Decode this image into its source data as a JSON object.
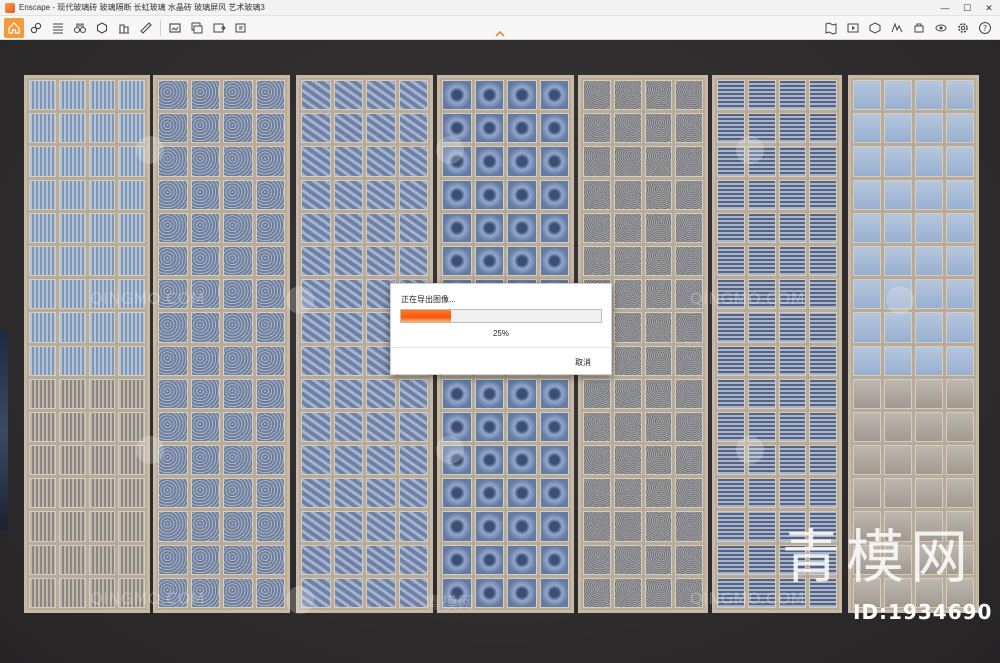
{
  "window": {
    "title": "Enscape - 现代玻璃砖 玻璃隔断 长虹玻璃 水晶砖 玻璃屏风 艺术玻璃3",
    "controls": [
      "—",
      "☐",
      "✕"
    ]
  },
  "toolbar": {
    "left_icons": [
      "home-icon",
      "link-icon",
      "list-icon",
      "binoculars-icon",
      "cube-icon",
      "building-icon",
      "ruler-icon",
      "screenshot-icon",
      "batch-render-icon",
      "export-icon",
      "settings-export-icon"
    ],
    "right_icons": [
      "map-icon",
      "video-icon",
      "asset-library-icon",
      "material-icon",
      "capture-icon",
      "visual-settings-icon",
      "settings-icon",
      "help-icon"
    ],
    "accent_color": "#f29b3a"
  },
  "dialog": {
    "title": "正在导出图像...",
    "progress_percent": 25,
    "percent_label": "25%",
    "cancel_label": "取消"
  },
  "watermarks": {
    "site": "QINGMO.COM",
    "site_cn": "青模网",
    "big_text": "青模网",
    "id_label": "ID:1934690"
  },
  "panels": [
    {
      "name": "ribbed-glass-panel",
      "tint": "#8aa4c4"
    },
    {
      "name": "textured-glass-panel",
      "tint": "#7d8fb0"
    },
    {
      "name": "wave-glass-panel",
      "tint": "#7e94bd"
    },
    {
      "name": "crystal-glass-panel",
      "tint": "#6f8ab8"
    },
    {
      "name": "frosted-glass-panel",
      "tint": "#87898e"
    },
    {
      "name": "striped-glass-panel",
      "tint": "#7a8eb3"
    },
    {
      "name": "clear-glass-panel",
      "tint": "#8fa9cc"
    }
  ]
}
